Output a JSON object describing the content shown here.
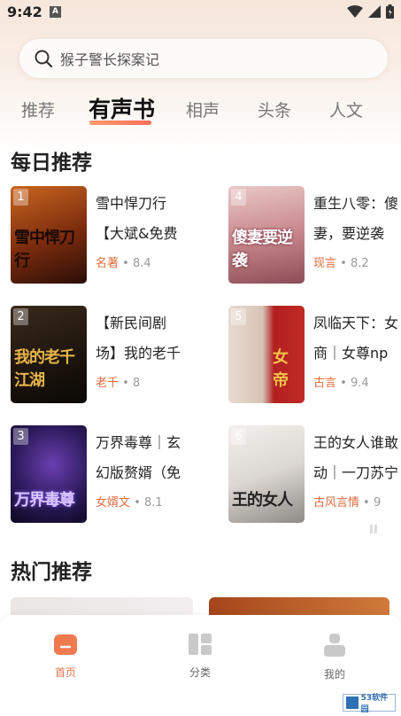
{
  "status": {
    "time": "9:42",
    "a_icon": "A"
  },
  "search": {
    "placeholder": "猴子警长探案记"
  },
  "tabs": [
    {
      "label": "推荐"
    },
    {
      "label": "有声书"
    },
    {
      "label": "相声"
    },
    {
      "label": "头条"
    },
    {
      "label": "人文"
    }
  ],
  "daily": {
    "title": "每日推荐",
    "books": [
      {
        "rank": "1",
        "line1": "雪中悍刀行",
        "line2": "【大斌&免费",
        "genre": "名著",
        "score": "8.4",
        "cover_title": "雪中悍刀行"
      },
      {
        "rank": "2",
        "line1": "【新民间剧",
        "line2": "场】我的老千",
        "genre": "老千",
        "score": "8",
        "cover_title": "我的老千江湖"
      },
      {
        "rank": "3",
        "line1": "万界毒尊｜玄",
        "line2": "幻版赘婿（免",
        "genre": "女婿文",
        "score": "8.1",
        "cover_title": "万界毒尊"
      },
      {
        "rank": "4",
        "line1": "重生八零：傻",
        "line2": "妻，要逆袭",
        "genre": "现言",
        "score": "8.2",
        "cover_title": "傻妻要逆袭"
      },
      {
        "rank": "5",
        "line1": "凤临天下：女",
        "line2": "商｜女尊np",
        "genre": "古言",
        "score": "9.4",
        "cover_title": "女帝"
      },
      {
        "rank": "6",
        "line1": "王的女人谁敢",
        "line2": "动｜一刀苏宁",
        "genre": "古风言情",
        "score": "9",
        "cover_title": "王的女人"
      }
    ]
  },
  "hot": {
    "title": "热门推荐"
  },
  "nav": [
    {
      "label": "首页"
    },
    {
      "label": "分类"
    },
    {
      "label": "我的"
    }
  ],
  "watermark": {
    "text": "53软件园"
  },
  "colors": {
    "accent": "#e7754c",
    "genre": "#e26b3c"
  }
}
